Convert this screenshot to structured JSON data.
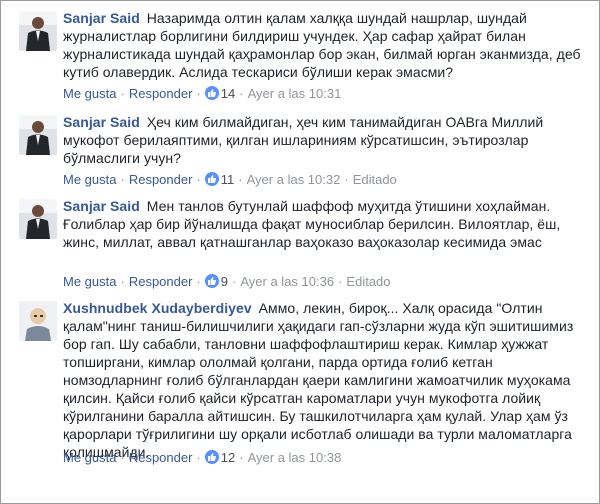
{
  "comments": [
    {
      "author": "Sanjar Said",
      "text": "Назаримда олтин қалам халққа шундай нашрлар, шундай журналистлар борлигини билдириш учундек. Ҳар сафар ҳайрат билан журналистикада шундай қаҳрамонлар бор экан, билмай юрган эканмизда, деб кутиб олавердик. Аслида тескариси бўлиши керак эмасми?",
      "like_label": "Me gusta",
      "reply_label": "Responder",
      "likes": "14",
      "time": "Ayer a las 10:31",
      "edited": ""
    },
    {
      "author": "Sanjar Said",
      "text": "Ҳеч ким билмайдиган, ҳеч ким танимайдиган ОАВга Миллий мукофот берилаяптими, қилган ишлариниям кўрсатишсин, эътирозлар бўлмаслиги учун?",
      "like_label": "Me gusta",
      "reply_label": "Responder",
      "likes": "11",
      "time": "Ayer a las 10:32",
      "edited": "Editado"
    },
    {
      "author": "Sanjar Said",
      "text": "Мен танлов бутунлай шаффоф муҳитда ўтишини хоҳлайман. Ғолиблар ҳар бир йўналишда фақат муносиблар берилсин. Вилоятлар, ёш, жинс, миллат, аввал қатнашганлар ваҳоказо ваҳоказолар кесимида эмас",
      "like_label": "Me gusta",
      "reply_label": "Responder",
      "likes": "9",
      "time": "Ayer a las 10:36",
      "edited": "Editado"
    },
    {
      "author": "Xushnudbek Xudayberdiyev",
      "text": "Аммо, лекин, бироқ... Халқ орасида \"Олтин қалам\"нинг таниш-билишчилиги ҳақидаги гап-сўзларни жуда кўп эшитишимиз бор гап. Шу сабабли, танловни шаффофлаштириш керак. Кимлар ҳужжат топширгани, кимлар ололмай қолгани, парда ортида ғолиб кетган номзодларнинг ғолиб бўлганлардан қаери камлигини жамоатчилик муҳокама қилсин. Қайси ғолиб қайси кўрсатган кароматлари учун мукофотга лойиқ кўрилганини баралла айтишсин. Бу ташкилотчиларга ҳам қулай. Улар ҳам ўз қарорлари тўғрилигини шу орқали исботлаб олишади ва турли маломатларга қолишмайди.",
      "like_label": "Me gusta",
      "reply_label": "Responder",
      "likes": "12",
      "time": "Ayer a las 10:38",
      "edited": ""
    }
  ],
  "colors": {
    "author": "#365899",
    "link": "#385898",
    "meta": "#90949c",
    "like_badge": "#5890ff"
  },
  "icons": {
    "like": "thumbs-up-icon"
  }
}
